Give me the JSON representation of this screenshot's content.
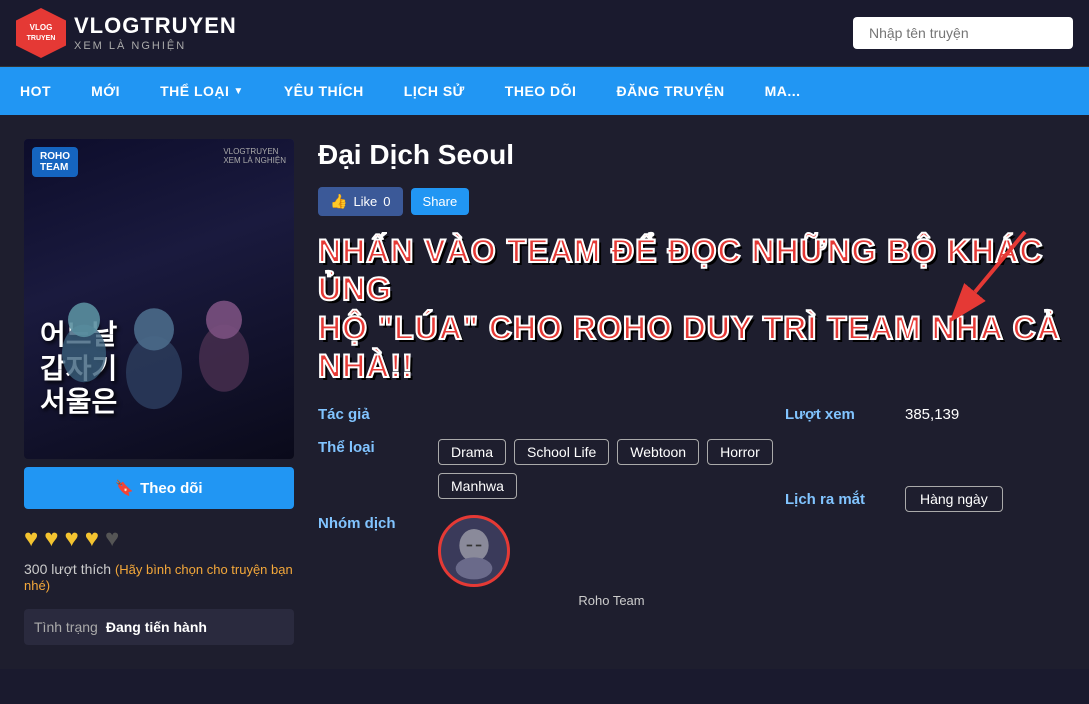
{
  "header": {
    "logo_line1": "VLOGTRUYEN",
    "logo_line2": "XEM LÀ NGHIỆN",
    "search_placeholder": "Nhập tên truyện"
  },
  "nav": {
    "items": [
      {
        "label": "HOT",
        "has_arrow": false
      },
      {
        "label": "MỚI",
        "has_arrow": false
      },
      {
        "label": "THỂ LOẠI",
        "has_arrow": true
      },
      {
        "label": "YÊU THÍCH",
        "has_arrow": false
      },
      {
        "label": "LỊCH SỬ",
        "has_arrow": false
      },
      {
        "label": "THEO DÕI",
        "has_arrow": false
      },
      {
        "label": "ĐĂNG TRUYỆN",
        "has_arrow": false
      },
      {
        "label": "MA...",
        "has_arrow": false
      }
    ]
  },
  "manga": {
    "title": "Đại Dịch Seoul",
    "like_label": "Like",
    "like_count": "0",
    "share_label": "Share",
    "promo_line1": "NHẤN VÀO TEAM ĐỂ ĐỌC NHỮNG BỘ KHÁC ỦNG",
    "promo_line2": "HỘ \"LÚA\" CHO ROHO DUY TRÌ TEAM NHA CẢ NHÀ!!",
    "tac_gia_label": "Tác giả",
    "tac_gia_value": "",
    "luot_xem_label": "Lượt xem",
    "luot_xem_value": "385,139",
    "the_loai_label": "Thể loại",
    "tags": [
      "Drama",
      "School Life",
      "Webtoon",
      "Horror",
      "Manhwa"
    ],
    "nhom_dich_label": "Nhóm dịch",
    "nhom_dich_name": "Roho Team",
    "lich_ra_mat_label": "Lịch ra mắt",
    "lich_ra_mat_value": "Hàng ngày",
    "follow_label": "Theo dõi",
    "rating_count": 4,
    "rating_max": 5,
    "likes_text": "300 lượt thích",
    "likes_cta": "(Hãy bình chọn cho truyện bạn nhé)",
    "tinh_trang_label": "Tình trạng",
    "tinh_trang_value": "Đang tiến hành"
  }
}
